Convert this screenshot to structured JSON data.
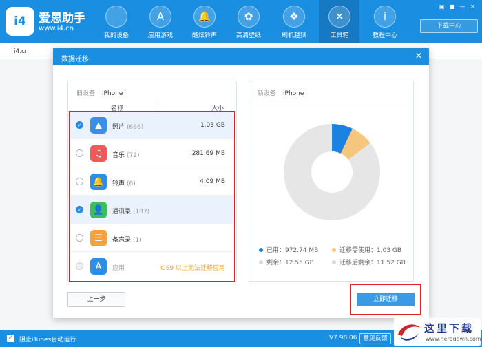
{
  "app": {
    "brand_name": "爱思助手",
    "brand_url": "www.i4.cn",
    "logo_text": "i4"
  },
  "nav": [
    {
      "label": "我的设备",
      "icon": "apple-icon",
      "glyph": ""
    },
    {
      "label": "应用游戏",
      "icon": "app-store-icon",
      "glyph": "A"
    },
    {
      "label": "酷炫铃声",
      "icon": "bell-icon",
      "glyph": "🔔"
    },
    {
      "label": "高清壁纸",
      "icon": "flower-icon",
      "glyph": "✿"
    },
    {
      "label": "刷机越狱",
      "icon": "dropbox-icon",
      "glyph": "❖"
    },
    {
      "label": "工具箱",
      "icon": "tools-icon",
      "glyph": "✕"
    },
    {
      "label": "教程中心",
      "icon": "info-icon",
      "glyph": "i"
    }
  ],
  "top_right": {
    "download_center": "下载中心",
    "controls": [
      "▣",
      "■",
      "—",
      "✕"
    ]
  },
  "tab": {
    "label": "i4.cn"
  },
  "dialog": {
    "title": "数据迁移",
    "close": "✕",
    "old_device_label": "旧设备",
    "old_device_name": "iPhone",
    "col_name": "名称",
    "col_size": "大小",
    "items": [
      {
        "name": "照片",
        "count": "(666)",
        "size": "1.03 GB",
        "checked": true,
        "icon": "photos-icon",
        "color": "#3a8ee6",
        "glyph": "▲"
      },
      {
        "name": "音乐",
        "count": "(72)",
        "size": "281.69 MB",
        "checked": false,
        "icon": "music-icon",
        "color": "#f0585a",
        "glyph": "♫"
      },
      {
        "name": "铃声",
        "count": "(6)",
        "size": "4.09 MB",
        "checked": false,
        "icon": "bell-icon",
        "color": "#2d8ee6",
        "glyph": "🔔"
      },
      {
        "name": "通讯录",
        "count": "(187)",
        "size": "",
        "checked": true,
        "icon": "contacts-icon",
        "color": "#3bbf5a",
        "glyph": "👤"
      },
      {
        "name": "备忘录",
        "count": "(1)",
        "size": "",
        "checked": false,
        "icon": "notes-icon",
        "color": "#f3a23c",
        "glyph": "☰"
      },
      {
        "name": "应用",
        "count": "",
        "size": "",
        "warning": "iOS9 以上无法迁移应用",
        "checked": false,
        "disabled": true,
        "icon": "app-store-icon",
        "color": "#2d8ee6",
        "glyph": "A"
      }
    ],
    "new_device_label": "新设备",
    "new_device_name": "iPhone",
    "storage": {
      "used_label": "已用：972.74 MB",
      "needed_label": "迁移需使用：1.03 GB",
      "free_label": "剩余：12.55 GB",
      "after_label": "迁移后剩余：11.52 GB",
      "used_gb": 0.95,
      "needed_gb": 1.03,
      "after_gb": 11.52,
      "colors": {
        "used": "#1a82e0",
        "needed": "#f5c77e",
        "free": "#e6e6e6"
      }
    },
    "prev_button": "上一步",
    "start_button": "立即迁移"
  },
  "status": {
    "block_itunes": "阻止iTunes自动运行",
    "block_check": "✓",
    "version": "V7.98.06",
    "feedback": "意见反馈"
  },
  "watermark": {
    "text": "这里下载",
    "url": "www.heredown.com"
  }
}
